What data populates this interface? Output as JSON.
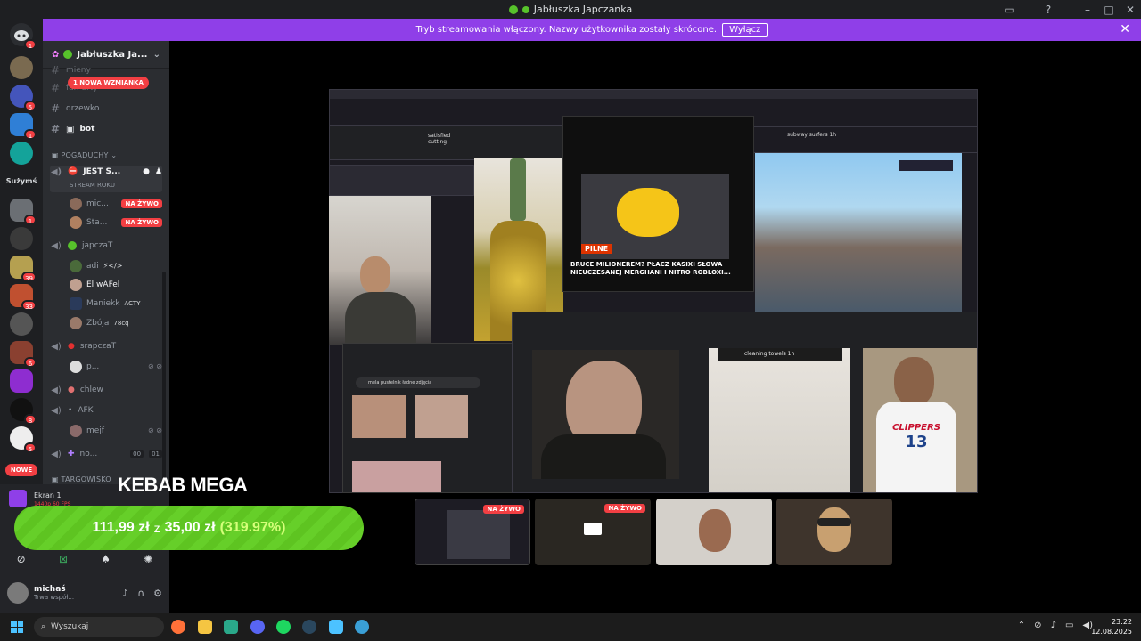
{
  "window": {
    "title": "Jabłuszka Japczanka"
  },
  "banner": {
    "text": "Tryb streamowania włączony. Nazwy użytkownika zostały skrócone.",
    "button": "Wyłącz"
  },
  "rail": {
    "label_suzyms": "Sużymś",
    "new_label": "NOWE",
    "badges": [
      "1",
      "1",
      "5",
      "1",
      "1",
      "39",
      "33",
      "6",
      "8",
      "5"
    ]
  },
  "sidebar": {
    "server_name": "Jabłuszka Ja...",
    "mention_pill": "1 NOWA WZMIANKA",
    "channels": [
      {
        "name": "mieny"
      },
      {
        "name": "fan-arty"
      },
      {
        "name": "drzewko"
      },
      {
        "name": "bot"
      }
    ],
    "category": "POGADUCHY",
    "voice_1": {
      "name": "JEST S...",
      "sub": "STREAM ROKU"
    },
    "voice_1_users": [
      {
        "name": "mic...",
        "live": "NA ŻYWO"
      },
      {
        "name": "Sta...",
        "live": "NA ŻYWO"
      }
    ],
    "voice_2": {
      "name": "japczaT"
    },
    "voice_2_users": [
      {
        "name": "adi",
        "extra": "⚡</>"
      },
      {
        "name": "El wAFel",
        "extra": ""
      },
      {
        "name": "Maniekk",
        "extra": "ACTY"
      },
      {
        "name": "Zbója",
        "extra": "78cq"
      }
    ],
    "voice_3": {
      "name": "srapczaT"
    },
    "voice_3_users": [
      {
        "name": "p..."
      }
    ],
    "voice_4": {
      "name": "chlew"
    },
    "voice_5": {
      "name": "AFK"
    },
    "voice_5_users": [
      {
        "name": "mejf"
      }
    ],
    "voice_6": {
      "name": "no...",
      "count_a": "00",
      "count_b": "01"
    },
    "category_2": "TARGOWISKO"
  },
  "voice_panel": {
    "screen": "Ekran 1",
    "quality": "1440p 60 FPS"
  },
  "user_panel": {
    "name": "michaś",
    "status": "Trwa współ..."
  },
  "stream": {
    "caption": "BRUCE MILIONEREM? PŁACZ KASIXI SŁOWA NIEUCZESANEJ MERGHANI I NITRO ROBLOXI...",
    "search_1": "satisfied cutting",
    "search_2": "cleaning towels 1h",
    "search_3": "subway surfers 1h",
    "search_4": "mela pustelnik ładne zdjęcia",
    "pilne": "PILNE"
  },
  "overlay": {
    "title": "KEBAB MEGA",
    "price_a": "111,99 zł",
    "price_mid": "z",
    "price_b": "35,00 zł",
    "price_pct": "(319.97%)"
  },
  "tiles": {
    "live_1": "NA ŻYWO",
    "live_2": "NA ŻYWO"
  },
  "taskbar": {
    "search": "Wyszukaj",
    "time": "23:22",
    "date": "12.08.2025"
  },
  "colors": {
    "accent": "#8f3fe8",
    "live": "#f23f43",
    "price": "#5ec421"
  }
}
